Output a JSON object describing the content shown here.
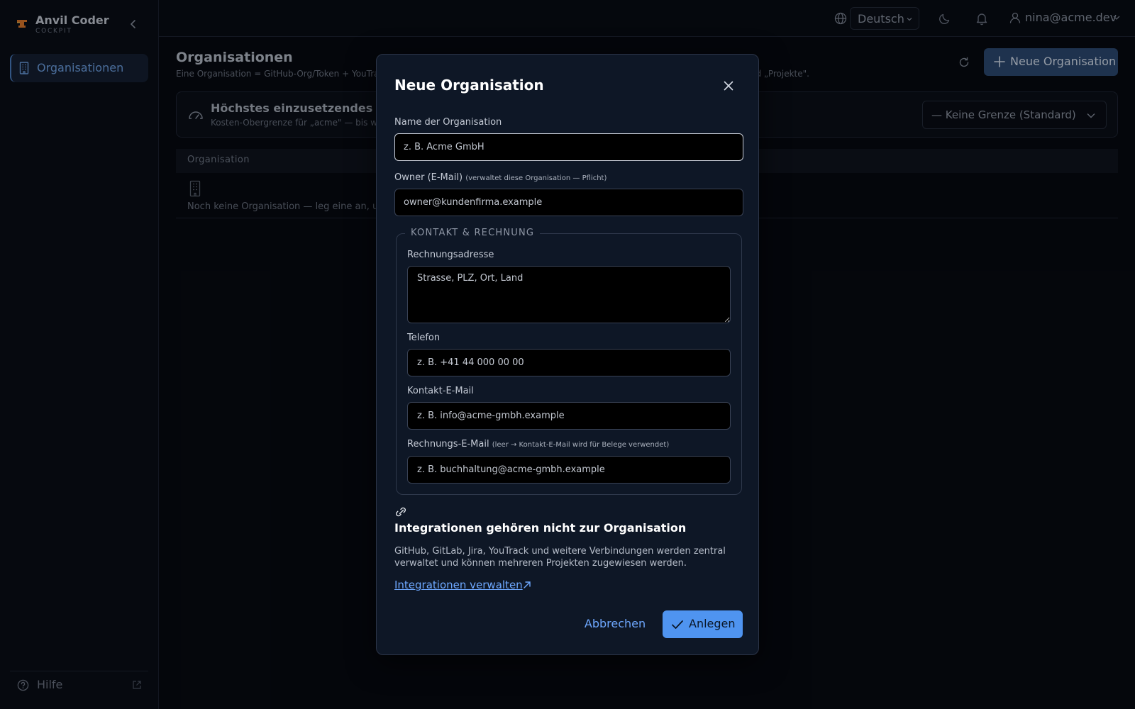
{
  "app": {
    "name": "Anvil Coder",
    "subtitle": "COCKPIT"
  },
  "sidebar": {
    "items": [
      {
        "label": "Organisationen",
        "icon": "building-icon",
        "active": true
      }
    ],
    "help_label": "Hilfe"
  },
  "topbar": {
    "language": "Deutsch",
    "user_email": "nina@acme.dev"
  },
  "page": {
    "title": "Organisationen",
    "subtitle_left": "Eine Organisation = GitHub-Org/Token + YouTra",
    "subtitle_right": "nd „Projekte\".",
    "new_button": "Neue Organisation",
    "limit": {
      "title": "Höchstes einzusetzendes Mod",
      "subtitle": "Kosten-Obergrenze für „acme\" — bis w",
      "selected": "— Keine Grenze (Standard)"
    },
    "table": {
      "columns": [
        "Organisation"
      ],
      "empty_text": "Noch keine Organisation — leg eine an, um l"
    }
  },
  "modal": {
    "title": "Neue Organisation",
    "name_label": "Name der Organisation",
    "name_placeholder": "z. B. Acme GmbH",
    "owner_label": "Owner (E-Mail)",
    "owner_hint": "(verwaltet diese Organisation — Pflicht)",
    "owner_placeholder": "owner@kundenfirma.example",
    "contact_legend": "KONTAKT & RECHNUNG",
    "billing_address_label": "Rechnungsadresse",
    "billing_address_placeholder": "Strasse, PLZ, Ort, Land",
    "phone_label": "Telefon",
    "phone_placeholder": "z. B. +41 44 000 00 00",
    "contact_email_label": "Kontakt-E-Mail",
    "contact_email_placeholder": "z. B. info@acme-gmbh.example",
    "billing_email_label": "Rechnungs-E-Mail",
    "billing_email_hint": "(leer → Kontakt-E-Mail wird für Belege verwendet)",
    "billing_email_placeholder": "z. B. buchhaltung@acme-gmbh.example",
    "integrations_title": "Integrationen gehören nicht zur Organisation",
    "integrations_text": "GitHub, GitLab, Jira, YouTrack und weitere Verbindungen werden zentral verwaltet und können mehreren Projekten zugewiesen werden.",
    "integrations_link": "Integrationen verwalten",
    "cancel_label": "Abbrechen",
    "submit_label": "Anlegen"
  },
  "colors": {
    "accent": "#4f94f0",
    "link": "#6ea8ff",
    "modal_bg": "#0e1726",
    "page_bg": "#070a11"
  }
}
